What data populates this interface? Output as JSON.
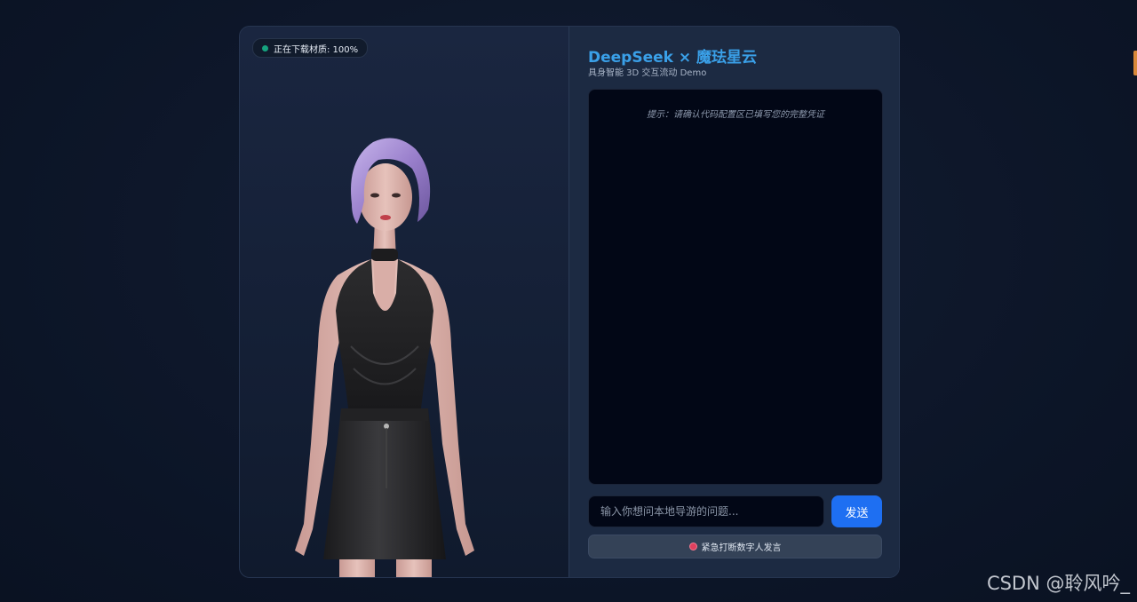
{
  "app": {
    "title_brand": "DeepSeek",
    "title_sep": "×",
    "title_partner": "魔珐星云",
    "subtitle": "具身智能 3D 交互流动 Demo"
  },
  "avatar": {
    "load_status": "正在下载材质: 100%",
    "status_color": "#16a37f"
  },
  "chat": {
    "hint": "提示：请确认代码配置区已填写您的完整凭证",
    "input_placeholder": "输入你想问本地导游的问题...",
    "input_value": "",
    "send_label": "发送",
    "interrupt_label": "紧急打断数字人发言"
  },
  "watermark": "CSDN @聆风吟_",
  "colors": {
    "background": "#0d1628",
    "card": "#17243a",
    "accent_title": "#3aa0e8",
    "send_button": "#1e6ff2",
    "interrupt_dot": "#e0405e"
  },
  "icons": {
    "status": "status-dot-icon",
    "interrupt": "stop-dot-icon"
  }
}
